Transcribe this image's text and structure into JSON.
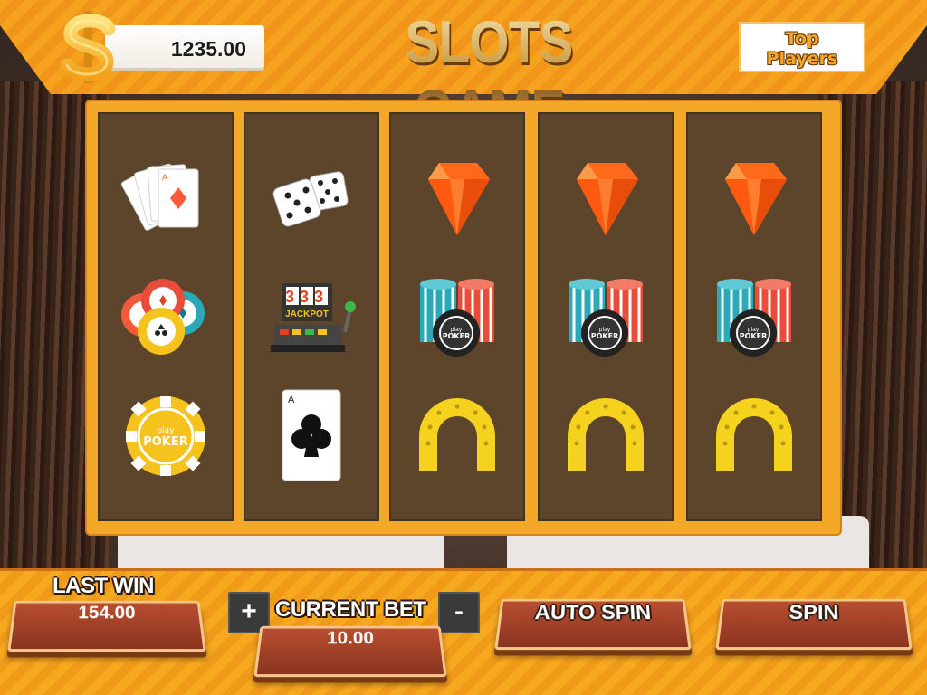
{
  "header": {
    "title": "SLOTS GAME",
    "balance": "1235.00",
    "currency_icon": "dollar-icon",
    "top_players": [
      "Top",
      "Players"
    ]
  },
  "reels": [
    [
      "playing-cards-icon",
      "casino-chips-pile-icon",
      "play-poker-chip-icon"
    ],
    [
      "dice-icon",
      "jackpot-slot-machine-icon",
      "ace-of-clubs-card-icon"
    ],
    [
      "diamond-gem-icon",
      "poker-chip-stacks-icon",
      "horseshoe-icon"
    ],
    [
      "diamond-gem-icon",
      "poker-chip-stacks-icon",
      "horseshoe-icon"
    ],
    [
      "diamond-gem-icon",
      "poker-chip-stacks-icon",
      "horseshoe-icon"
    ]
  ],
  "symbol_text": {
    "jackpot_digits": "333",
    "jackpot_label": "JACKPOT",
    "chip_small": "play",
    "chip_big": "POKER"
  },
  "footer": {
    "last_win_label": "LAST WIN",
    "last_win_value": "154.00",
    "current_bet_label": "CURRENT BET",
    "current_bet_value": "10.00",
    "plus_label": "+",
    "minus_label": "-",
    "auto_spin_label": "AUTO SPIN",
    "spin_label": "SPIN"
  },
  "colors": {
    "accent_orange": "#f4a828",
    "plate_red": "#a8442a",
    "gem_orange": "#ff6a1a",
    "horseshoe_yellow": "#f5d21e"
  }
}
